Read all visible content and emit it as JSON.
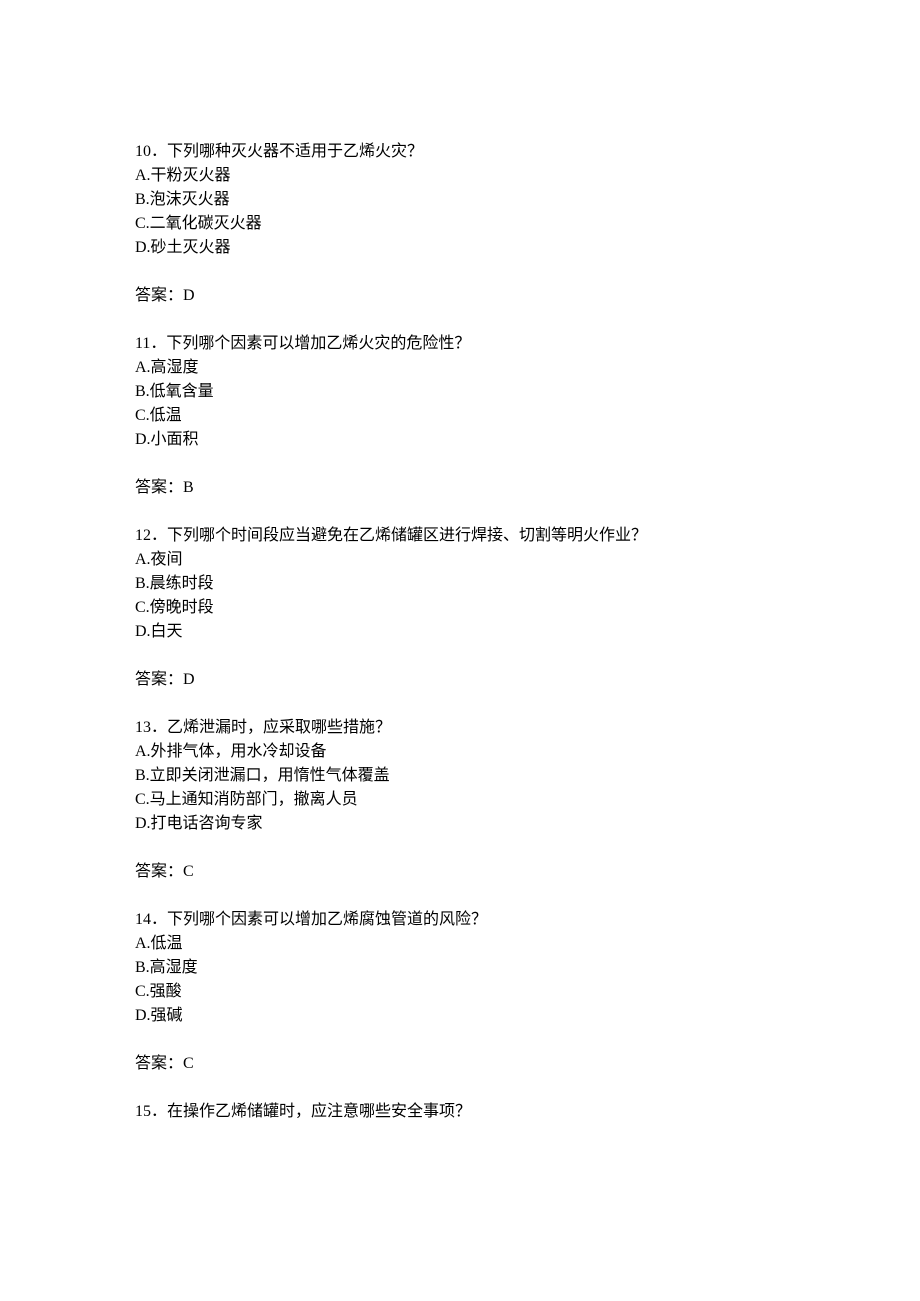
{
  "questions": [
    {
      "num": "10",
      "text": "．下列哪种灭火器不适用于乙烯火灾？",
      "options": [
        "A.干粉灭火器",
        "B.泡沫灭火器",
        "C.二氧化碳灭火器",
        "D.砂土灭火器"
      ],
      "answer_label": "答案：",
      "answer": "D"
    },
    {
      "num": "11",
      "text": "．下列哪个因素可以增加乙烯火灾的危险性？",
      "options": [
        "A.高湿度",
        "B.低氧含量",
        "C.低温",
        "D.小面积"
      ],
      "answer_label": "答案：",
      "answer": "B"
    },
    {
      "num": "12",
      "text": "．下列哪个时间段应当避免在乙烯储罐区进行焊接、切割等明火作业？",
      "options": [
        "A.夜间",
        "B.晨练时段",
        "C.傍晚时段",
        "D.白天"
      ],
      "answer_label": "答案：",
      "answer": "D"
    },
    {
      "num": "13",
      "text": "．乙烯泄漏时，应采取哪些措施？",
      "options": [
        "A.外排气体，用水冷却设备",
        "B.立即关闭泄漏口，用惰性气体覆盖",
        "C.马上通知消防部门，撤离人员",
        "D.打电话咨询专家"
      ],
      "answer_label": "答案：",
      "answer": "C"
    },
    {
      "num": "14",
      "text": "．下列哪个因素可以增加乙烯腐蚀管道的风险？",
      "options": [
        "A.低温",
        "B.高湿度",
        "C.强酸",
        "D.强碱"
      ],
      "answer_label": "答案：",
      "answer": "C"
    },
    {
      "num": "15",
      "text": "．在操作乙烯储罐时，应注意哪些安全事项？",
      "options": [],
      "answer_label": "",
      "answer": ""
    }
  ]
}
